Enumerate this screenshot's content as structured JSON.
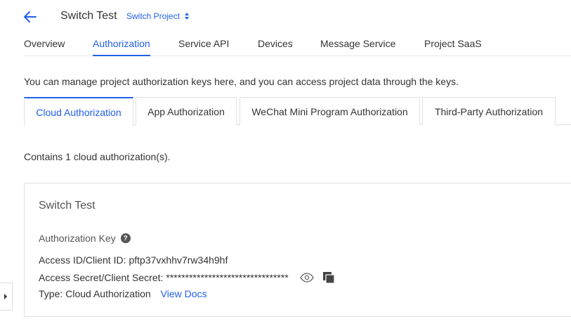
{
  "header": {
    "title": "Switch Test",
    "switch_project_label": "Switch Project"
  },
  "main_tabs": [
    {
      "label": "Overview"
    },
    {
      "label": "Authorization",
      "active": true
    },
    {
      "label": "Service API"
    },
    {
      "label": "Devices"
    },
    {
      "label": "Message Service"
    },
    {
      "label": "Project SaaS"
    }
  ],
  "intro_text": "You can manage project authorization keys here, and you can access project data through the keys.",
  "sub_tabs": [
    {
      "label": "Cloud Authorization",
      "active": true
    },
    {
      "label": "App Authorization"
    },
    {
      "label": "WeChat Mini Program Authorization"
    },
    {
      "label": "Third-Party Authorization"
    }
  ],
  "count_text": "Contains 1 cloud authorization(s).",
  "card": {
    "title": "Switch Test",
    "key_heading": "Authorization Key",
    "access_id_label": "Access ID/Client ID:",
    "access_id_value": "pftp37vxhhv7rw34h9hf",
    "secret_label": "Access Secret/Client Secret:",
    "secret_value": "********************************",
    "type_label": "Type:",
    "type_value": "Cloud Authorization",
    "view_docs_label": "View Docs"
  },
  "colors": {
    "accent": "#2160e8",
    "text": "#333333",
    "border": "#e0e0e0"
  },
  "icons": {
    "back": "arrow-left-icon",
    "sort": "sort-icon",
    "help": "question-circle-icon",
    "reveal": "eye-icon",
    "copy": "copy-icon",
    "expand": "caret-right-icon"
  }
}
